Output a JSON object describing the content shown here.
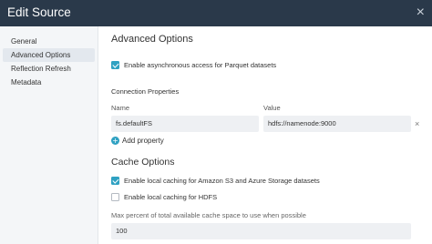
{
  "window": {
    "title": "Edit Source",
    "close_glyph": "×"
  },
  "sidebar": {
    "items": [
      {
        "label": "General"
      },
      {
        "label": "Advanced Options",
        "active": true
      },
      {
        "label": "Reflection Refresh"
      },
      {
        "label": "Metadata"
      }
    ]
  },
  "main": {
    "title": "Advanced Options",
    "async_access": {
      "label": "Enable asynchronous access for Parquet datasets",
      "checked": true
    },
    "connection": {
      "title": "Connection Properties",
      "name_header": "Name",
      "value_header": "Value",
      "rows": [
        {
          "name": "fs.defaultFS",
          "value": "hdfs://namenode:9000"
        }
      ],
      "remove_glyph": "×",
      "add_label": "Add property",
      "add_glyph": "+"
    },
    "cache": {
      "title": "Cache Options",
      "s3_azure": {
        "label": "Enable local caching for Amazon S3 and Azure Storage datasets",
        "checked": true
      },
      "hdfs": {
        "label": "Enable local caching for HDFS",
        "checked": false
      },
      "max_percent_label": "Max percent of total available cache space to use when possible",
      "max_percent_value": "100"
    }
  },
  "colors": {
    "titlebar": "#2a394a",
    "accent": "#2fa1c2",
    "sidebar_bg": "#f4f6f8",
    "field_bg": "#eef0f3"
  }
}
